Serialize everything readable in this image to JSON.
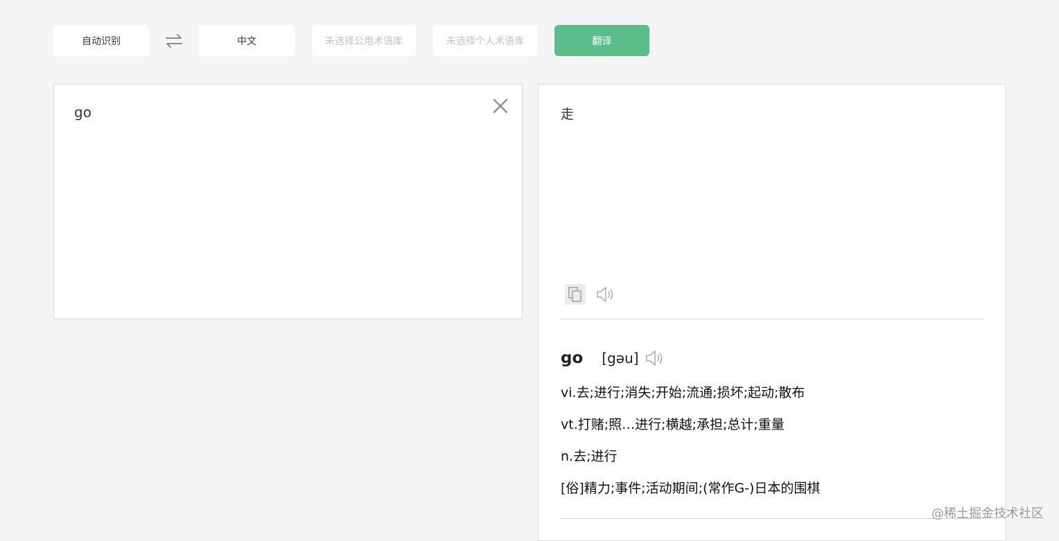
{
  "toolbar": {
    "source_lang": "自动识别",
    "target_lang": "中文",
    "public_glossary": "未选择公用术语库",
    "personal_glossary": "未选择个人术语库",
    "translate_label": "翻译"
  },
  "source": {
    "text": "go"
  },
  "target": {
    "text": "走"
  },
  "dictionary": {
    "word": "go",
    "phonetic": "[gəu]",
    "definitions": [
      "vi.去;进行;消失;开始;流通;损坏;起动;散布",
      "vt.打赌;照…进行;横越;承担;总计;重量",
      "n.去;进行",
      "[俗]精力;事件;活动期间;(常作G-)日本的围棋"
    ]
  },
  "watermark": "@稀土掘金技术社区",
  "colors": {
    "accent": "#5cbd8b",
    "background": "#f5f5f5"
  }
}
